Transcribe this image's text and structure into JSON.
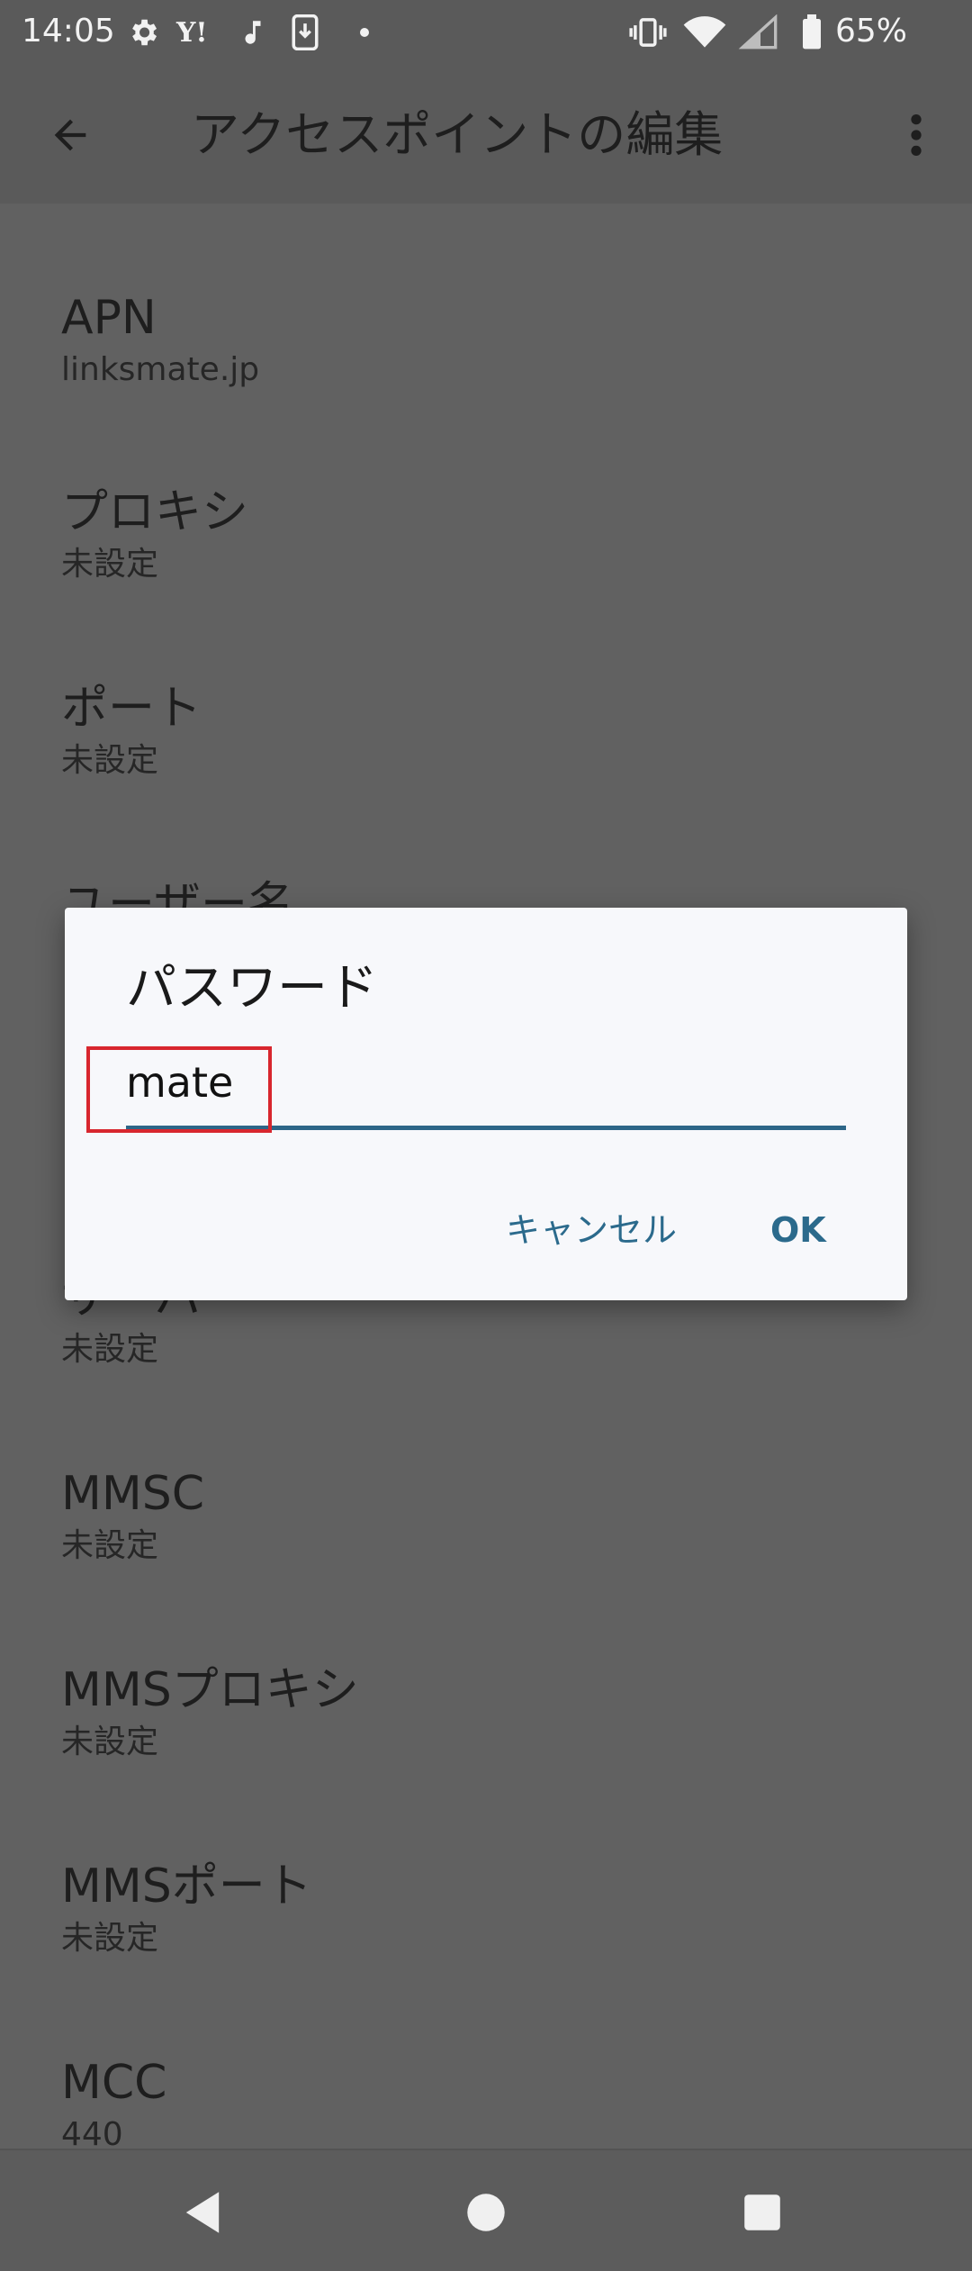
{
  "status_bar": {
    "time": "14:05",
    "battery_percent": "65%",
    "icons": [
      "gear-icon",
      "yahoo-icon",
      "music-note-icon",
      "download-icon",
      "dot-icon",
      "vibrate-icon",
      "wifi-icon",
      "signal-icon",
      "battery-icon"
    ]
  },
  "app_bar": {
    "title": "アクセスポイントの編集",
    "back_icon": "arrow-back-icon",
    "more_icon": "more-vert-icon"
  },
  "settings": [
    {
      "title": "APN",
      "value": "linksmate.jp"
    },
    {
      "title": "プロキシ",
      "value": "未設定"
    },
    {
      "title": "ポート",
      "value": "未設定"
    },
    {
      "title": "ユーザー名",
      "value": ""
    },
    {
      "title": "サーバー",
      "value": "未設定"
    },
    {
      "title": "MMSC",
      "value": "未設定"
    },
    {
      "title": "MMSプロキシ",
      "value": "未設定"
    },
    {
      "title": "MMSポート",
      "value": "未設定"
    },
    {
      "title": "MCC",
      "value": "440"
    }
  ],
  "dialog": {
    "title": "パスワード",
    "input_value": "mate",
    "cancel_label": "キャンセル",
    "ok_label": "OK"
  },
  "colors": {
    "accent": "#2d6688",
    "highlight": "#d8262e",
    "scrim_background": "#616161"
  }
}
